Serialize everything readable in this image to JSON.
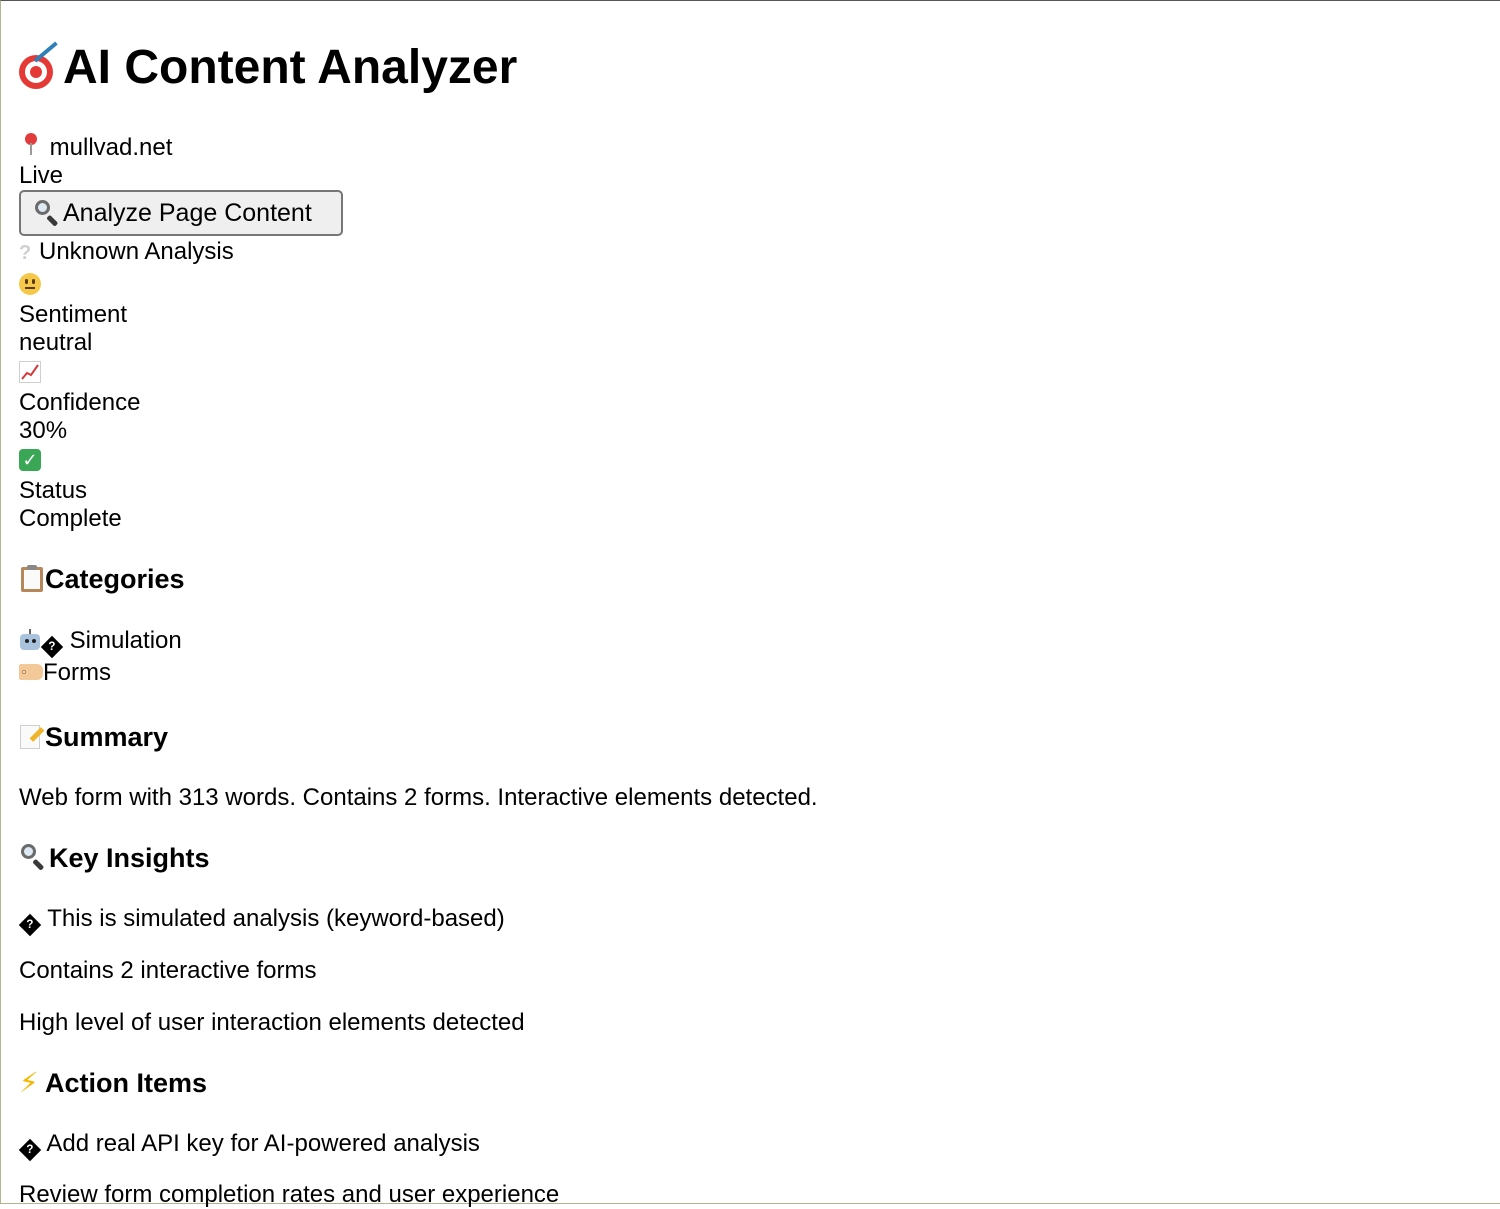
{
  "header": {
    "title": "AI Content Analyzer",
    "title_icon": "dart-target-icon"
  },
  "site": {
    "domain": "mullvad.net",
    "status": "Live"
  },
  "analyze_button": {
    "label": "Analyze Page Content"
  },
  "analysis": {
    "type_label": "Unknown Analysis",
    "metrics": [
      {
        "icon": "neutral-face-icon",
        "label": "Sentiment",
        "value": "neutral"
      },
      {
        "icon": "chart-increasing-icon",
        "label": "Confidence",
        "value": "30%"
      },
      {
        "icon": "check-mark-icon",
        "label": "Status",
        "value": "Complete"
      }
    ]
  },
  "categories": {
    "heading": "Categories",
    "items": [
      {
        "icon": "robot-icon",
        "label": "Simulation"
      },
      {
        "icon": "tag-icon",
        "label": "Forms"
      }
    ]
  },
  "summary": {
    "heading": "Summary",
    "text": "Web form with 313 words. Contains 2 forms. Interactive elements detected."
  },
  "insights": {
    "heading": "Key Insights",
    "items": [
      "This is simulated analysis (keyword-based)",
      "Contains 2 interactive forms",
      "High level of user interaction elements detected"
    ]
  },
  "actions": {
    "heading": "Action Items",
    "items": [
      "Add real API key for AI-powered analysis",
      "Review form completion rates and user experience"
    ]
  },
  "colors": {
    "button_bg": "#efefef",
    "button_border": "#767676",
    "text": "#000000"
  }
}
